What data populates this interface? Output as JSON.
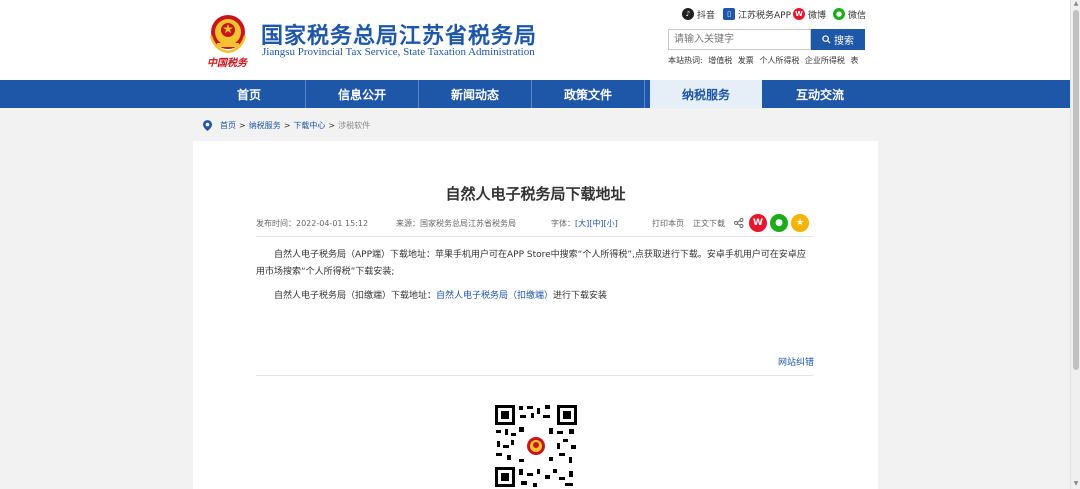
{
  "header": {
    "title": "国家税务总局江苏省税务局",
    "subtitle": "Jiangsu Provincial Tax Service, State Taxation Administration",
    "calligraphy": "中国税务",
    "social": [
      {
        "label": "抖音",
        "icon": "douyin-icon",
        "color": "#222222"
      },
      {
        "label": "江苏税务APP",
        "icon": "app-icon",
        "color": "#1e56a8"
      },
      {
        "label": "微博",
        "icon": "weibo-icon",
        "color": "#e6162d"
      },
      {
        "label": "微信",
        "icon": "wechat-icon",
        "color": "#1aad19"
      }
    ],
    "search_placeholder": "请输入关键字",
    "search_button": "搜索",
    "hot_label": "本站热词:",
    "hot_words": [
      "增值税",
      "发票",
      "个人所得税",
      "企业所得税",
      "表"
    ]
  },
  "nav": {
    "items": [
      {
        "label": "首页"
      },
      {
        "label": "信息公开"
      },
      {
        "label": "新闻动态"
      },
      {
        "label": "政策文件"
      },
      {
        "label": "纳税服务"
      },
      {
        "label": "互动交流"
      }
    ],
    "active_index": 4
  },
  "breadcrumb": {
    "items": [
      "首页",
      "纳税服务",
      "下载中心",
      "涉税软件"
    ],
    "separator": ">"
  },
  "article": {
    "title": "自然人电子税务局下载地址",
    "published_label": "发布时间：",
    "published": "2022-04-01 15:12",
    "source_label": "来源：",
    "source": "国家税务总局江苏省税务局",
    "font_label": "字体：",
    "font_sizes": [
      "大",
      "中",
      "小"
    ],
    "print_label": "打印本页",
    "download_label": "正文下载",
    "paragraph1": "自然人电子税务局（APP端）下载地址：苹果手机用户可在APP Store中搜索“个人所得税”,点获取进行下载。安卓手机用户可在安卓应用市场搜索“个人所得税”下载安装;",
    "paragraph2_prefix": "自然人电子税务局（扣缴端）下载地址：",
    "paragraph2_link": "自然人电子税务局（扣缴端）",
    "paragraph2_suffix": "进行下载安装",
    "correction": "网站纠错"
  },
  "colors": {
    "brand_blue": "#1e56a8",
    "nav_active_bg": "#e6eef8",
    "weibo_red": "#e6162d",
    "wechat_green": "#1aad19",
    "favorite_yellow": "#f5b400"
  }
}
